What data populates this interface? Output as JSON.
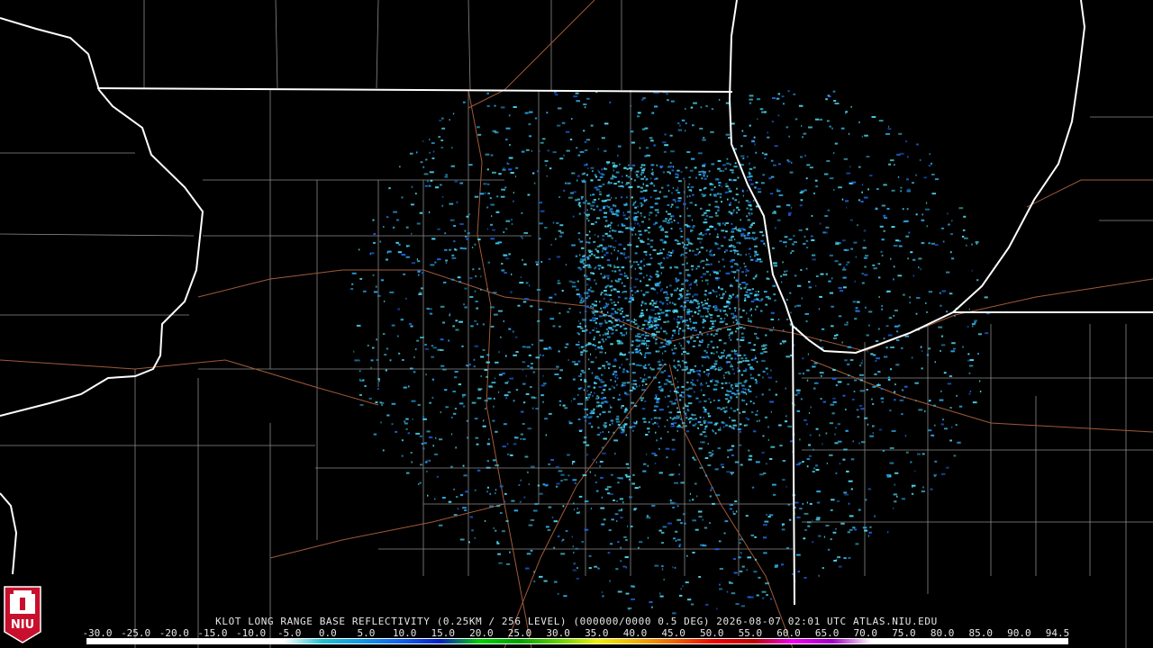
{
  "product": {
    "caption": "KLOT LONG RANGE BASE REFLECTIVITY (0.25KM / 256 LEVEL) (000000/0000 0.5 DEG) 2026-08-07 02:01 UTC  ATLAS.NIU.EDU"
  },
  "scale": {
    "labels": [
      "-30.0",
      "-25.0",
      "-20.0",
      "-15.0",
      "-10.0",
      "-5.0",
      "0.0",
      "5.0",
      "10.0",
      "15.0",
      "20.0",
      "25.0",
      "30.0",
      "35.0",
      "40.0",
      "45.0",
      "50.0",
      "55.0",
      "60.0",
      "65.0",
      "70.0",
      "75.0",
      "80.0",
      "85.0",
      "90.0",
      "94.5"
    ],
    "colors": [
      "#ffffff",
      "#ffffff",
      "#ffffff",
      "#ffffff",
      "#ffffff",
      "#ffffff",
      "#20c0d0",
      "#1098e0",
      "#1060f0",
      "#0020c0",
      "#00d000",
      "#00a000",
      "#60d000",
      "#f0f000",
      "#f0b000",
      "#f06000",
      "#f00000",
      "#c00000",
      "#f000f0",
      "#a000c0",
      "#ffffff",
      "#ffffff",
      "#ffffff",
      "#ffffff",
      "#ffffff",
      "#ffffff"
    ]
  },
  "colors": {
    "background": "#000000",
    "state_border": "#ffffff",
    "county_border": "#8a8a8a",
    "highway": "#a05a38",
    "echo_light": "#50d8f0",
    "echo_mid": "#2aa8e8",
    "echo_dark": "#1c62e0"
  },
  "logo": {
    "text": "NIU",
    "color": "#c8102e"
  }
}
